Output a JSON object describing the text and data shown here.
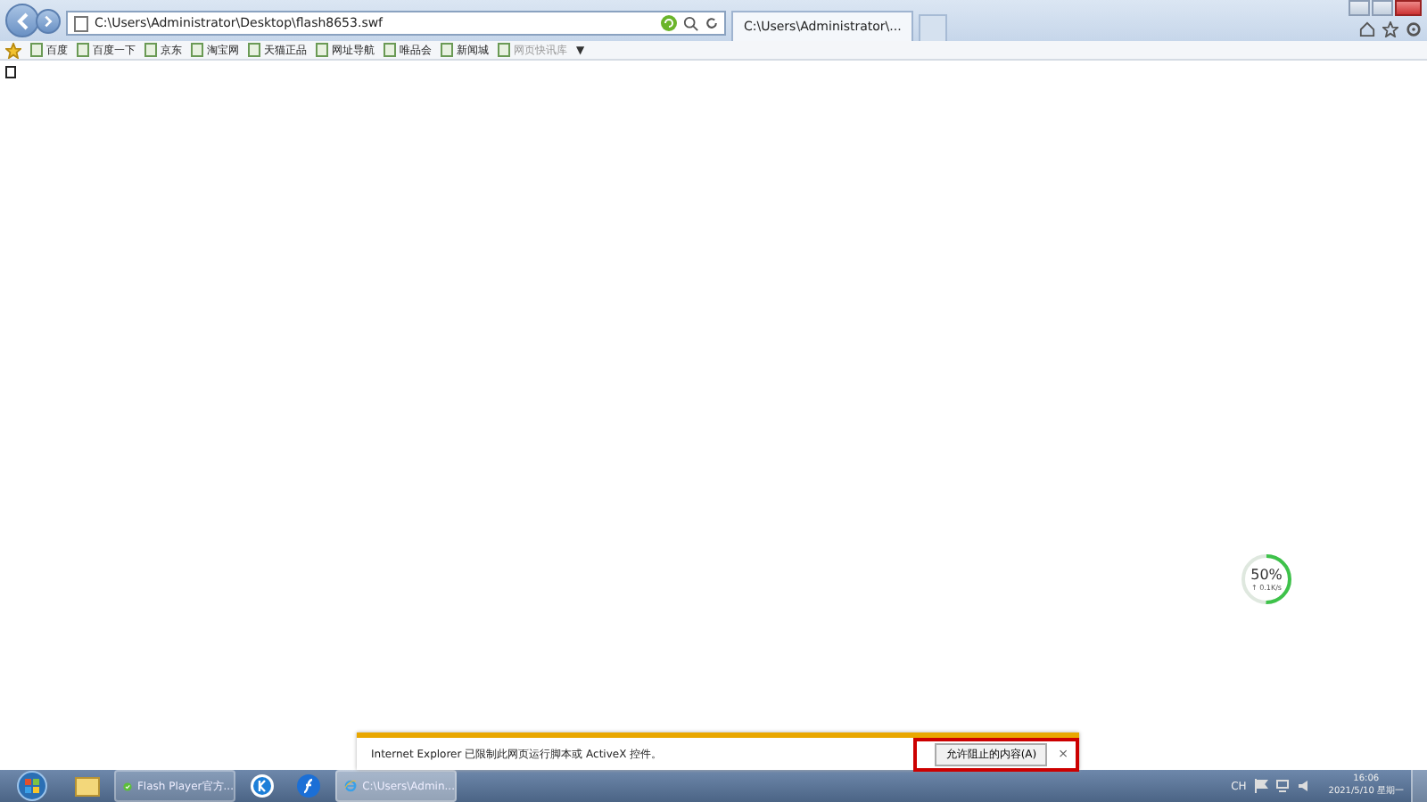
{
  "address_bar": {
    "value": "C:\\Users\\Administrator\\Desktop\\flash8653.swf"
  },
  "tabs": [
    {
      "label": "C:\\Users\\Administrator\\...",
      "selected": true
    }
  ],
  "favorites": [
    {
      "label": "百度",
      "disabled": false
    },
    {
      "label": "百度一下",
      "disabled": false
    },
    {
      "label": "京东",
      "disabled": false
    },
    {
      "label": "淘宝网",
      "disabled": false
    },
    {
      "label": "天猫正品",
      "disabled": false
    },
    {
      "label": "网址导航",
      "disabled": false
    },
    {
      "label": "唯品会",
      "disabled": false
    },
    {
      "label": "新闻城",
      "disabled": false
    },
    {
      "label": "网页快讯库",
      "disabled": true
    }
  ],
  "favorites_more": "▼",
  "speed_widget": {
    "percent": "50%",
    "rate": "↑ 0.1K/s",
    "level": 0.5
  },
  "info_bar": {
    "message": "Internet Explorer 已限制此网页运行脚本或 ActiveX 控件。",
    "button": "允许阻止的内容(A)",
    "close": "×"
  },
  "taskbar": {
    "items": [
      {
        "kind": "folder",
        "selected": false
      },
      {
        "kind": "player",
        "label": "Flash Player官方...",
        "selected": false
      },
      {
        "kind": "k",
        "selected": false
      },
      {
        "kind": "flash",
        "selected": false
      },
      {
        "kind": "ie",
        "label": "C:\\Users\\Admin...",
        "selected": true
      }
    ],
    "tray": {
      "language": "CH",
      "time": "16:06",
      "date": "2021/5/10 星期一"
    }
  }
}
